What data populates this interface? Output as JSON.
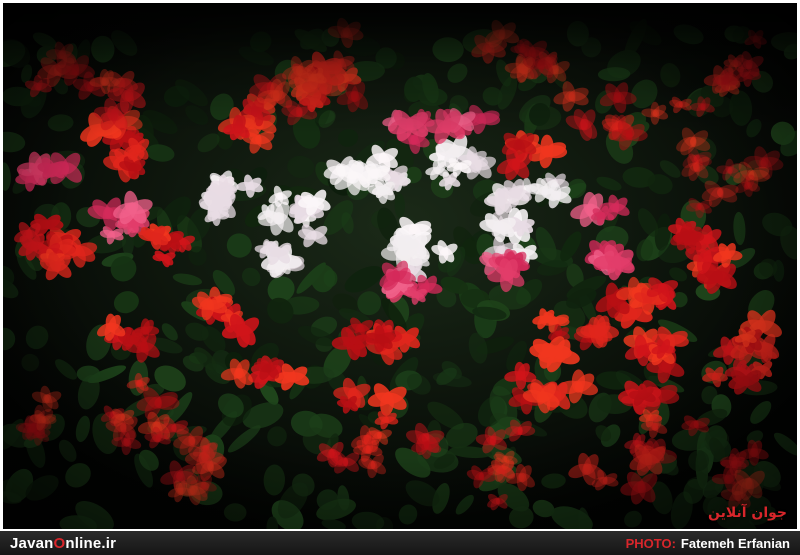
{
  "site": {
    "logo_part1": "Javan",
    "logo_accent": "O",
    "logo_part2": "nline.ir"
  },
  "credit": {
    "label": "PHOTO:",
    "name": "Fatemeh Erfanian"
  },
  "watermark": {
    "text": "جوان آنلاین"
  },
  "colors": {
    "accent": "#d8262b",
    "bar": "#1f1f1f",
    "background": "#050505",
    "flower_red": "#d0141a",
    "flower_pink": "#e23d6a",
    "flower_white": "#f2eef0",
    "leaf": "#1c2a1c"
  }
}
